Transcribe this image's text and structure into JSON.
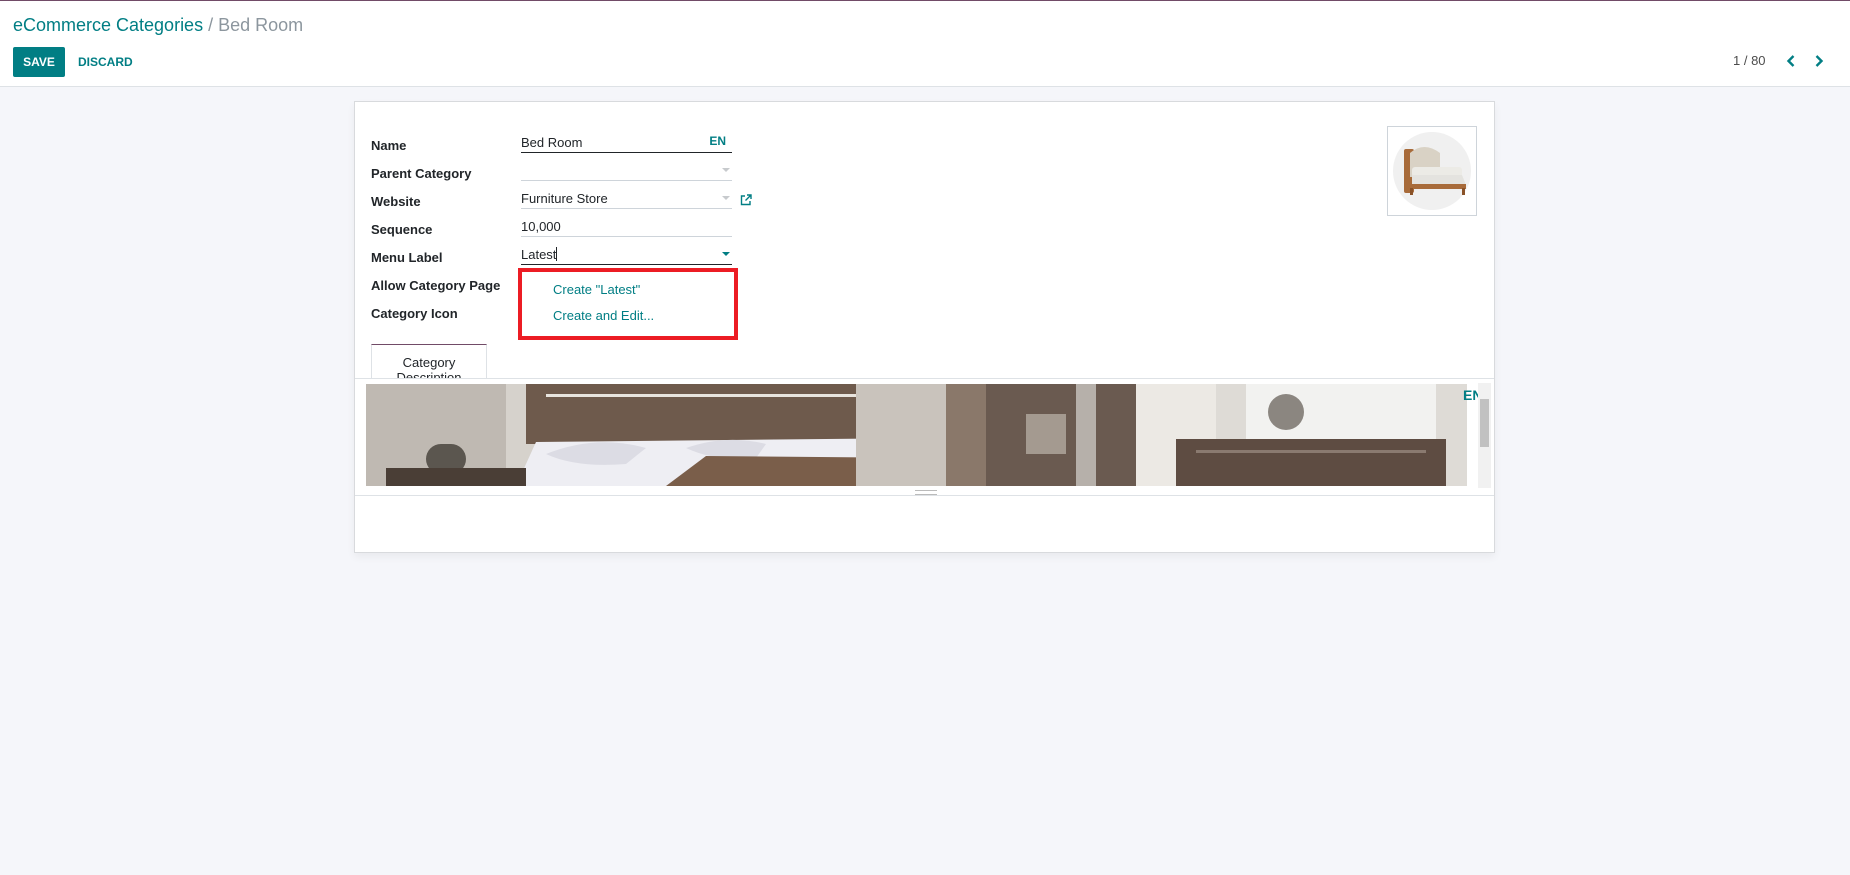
{
  "breadcrumb": {
    "parent": "eCommerce Categories",
    "separator": "/",
    "current": "Bed Room"
  },
  "toolbar": {
    "save_label": "SAVE",
    "discard_label": "DISCARD"
  },
  "pager": {
    "value": "1 / 80"
  },
  "form": {
    "fields": {
      "name": {
        "label": "Name",
        "value": "Bed Room",
        "lang": "EN"
      },
      "parent_category": {
        "label": "Parent Category",
        "value": ""
      },
      "website": {
        "label": "Website",
        "value": "Furniture Store"
      },
      "sequence": {
        "label": "Sequence",
        "value": "10,000"
      },
      "menu_label": {
        "label": "Menu Label",
        "value": "Latest"
      },
      "allow_category_page": {
        "label": "Allow Category Page"
      },
      "category_icon": {
        "label": "Category Icon"
      }
    },
    "dropdown": {
      "create": "Create \"Latest\"",
      "create_edit": "Create and Edit..."
    },
    "tabs": [
      {
        "label": "Category Description"
      }
    ],
    "editor": {
      "lang": "EN"
    }
  },
  "colors": {
    "accent": "#017e84",
    "highlight_border": "#ec1c24",
    "brand": "#714b67"
  }
}
